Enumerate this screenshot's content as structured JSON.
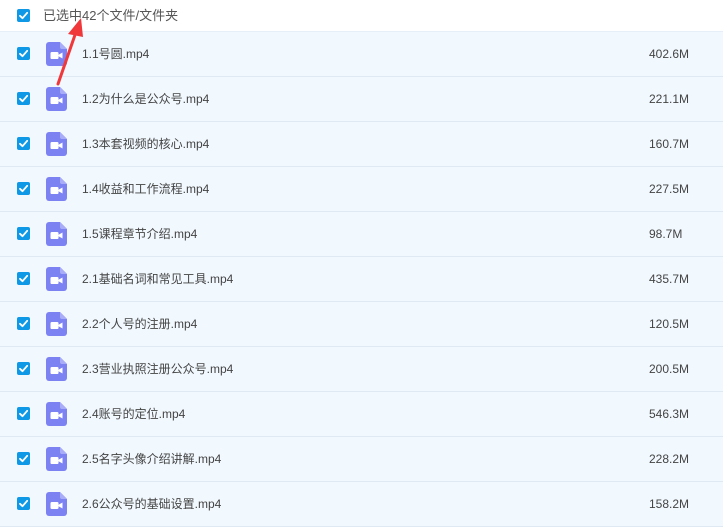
{
  "header": {
    "selection_text": "已选中42个文件/文件夹",
    "checked": true
  },
  "colors": {
    "checkbox": "#0e98e6",
    "row_bg": "#f1f8fe",
    "video_icon": "#7c82f1",
    "arrow": "#f0383b"
  },
  "files": [
    {
      "name": "1.1号圆.mp4",
      "size": "402.6M",
      "checked": true,
      "icon": "video-file-icon"
    },
    {
      "name": "1.2为什么是公众号.mp4",
      "size": "221.1M",
      "checked": true,
      "icon": "video-file-icon"
    },
    {
      "name": "1.3本套视频的核心.mp4",
      "size": "160.7M",
      "checked": true,
      "icon": "video-file-icon"
    },
    {
      "name": "1.4收益和工作流程.mp4",
      "size": "227.5M",
      "checked": true,
      "icon": "video-file-icon"
    },
    {
      "name": "1.5课程章节介绍.mp4",
      "size": "98.7M",
      "checked": true,
      "icon": "video-file-icon"
    },
    {
      "name": "2.1基础名词和常见工具.mp4",
      "size": "435.7M",
      "checked": true,
      "icon": "video-file-icon"
    },
    {
      "name": "2.2个人号的注册.mp4",
      "size": "120.5M",
      "checked": true,
      "icon": "video-file-icon"
    },
    {
      "name": "2.3营业执照注册公众号.mp4",
      "size": "200.5M",
      "checked": true,
      "icon": "video-file-icon"
    },
    {
      "name": "2.4账号的定位.mp4",
      "size": "546.3M",
      "checked": true,
      "icon": "video-file-icon"
    },
    {
      "name": "2.5名字头像介绍讲解.mp4",
      "size": "228.2M",
      "checked": true,
      "icon": "video-file-icon"
    },
    {
      "name": "2.6公众号的基础设置.mp4",
      "size": "158.2M",
      "checked": true,
      "icon": "video-file-icon"
    }
  ]
}
